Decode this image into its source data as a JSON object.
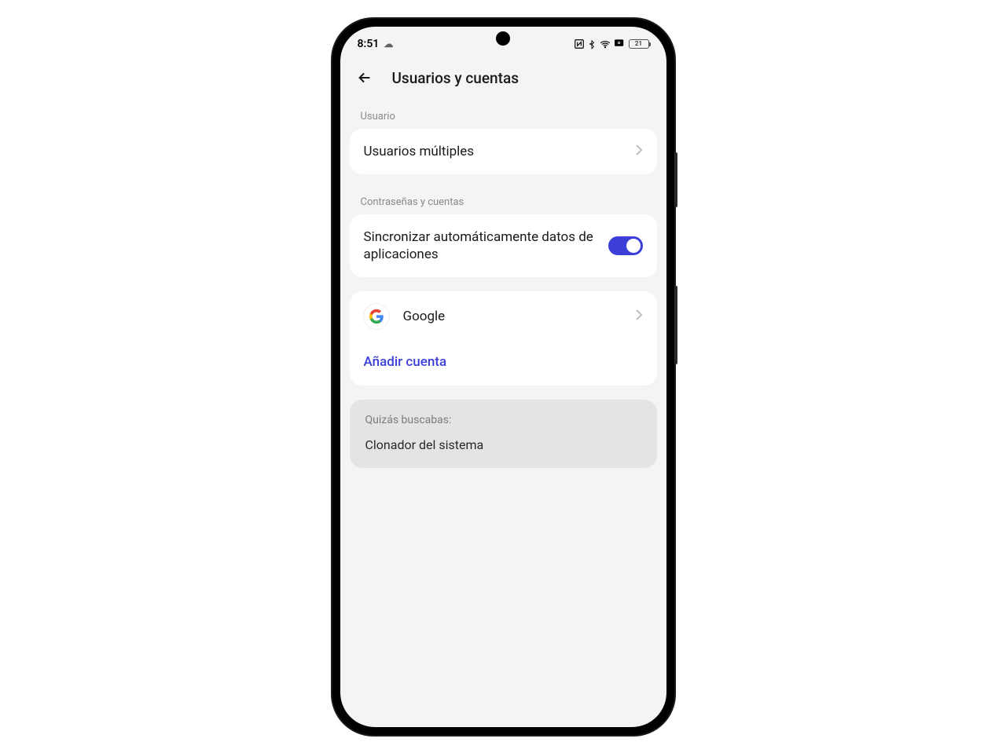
{
  "status": {
    "time": "8:51",
    "battery_level": "21"
  },
  "header": {
    "title": "Usuarios y cuentas"
  },
  "sections": {
    "user_label": "Usuario",
    "multiple_users": "Usuarios múltiples",
    "passwords_label": "Contraseñas y cuentas",
    "auto_sync": "Sincronizar automáticamente datos de aplicaciones",
    "google_account": "Google",
    "add_account": "Añadir cuenta",
    "maybe_looking": "Quizás buscabas:",
    "system_cloner": "Clonador del sistema"
  }
}
